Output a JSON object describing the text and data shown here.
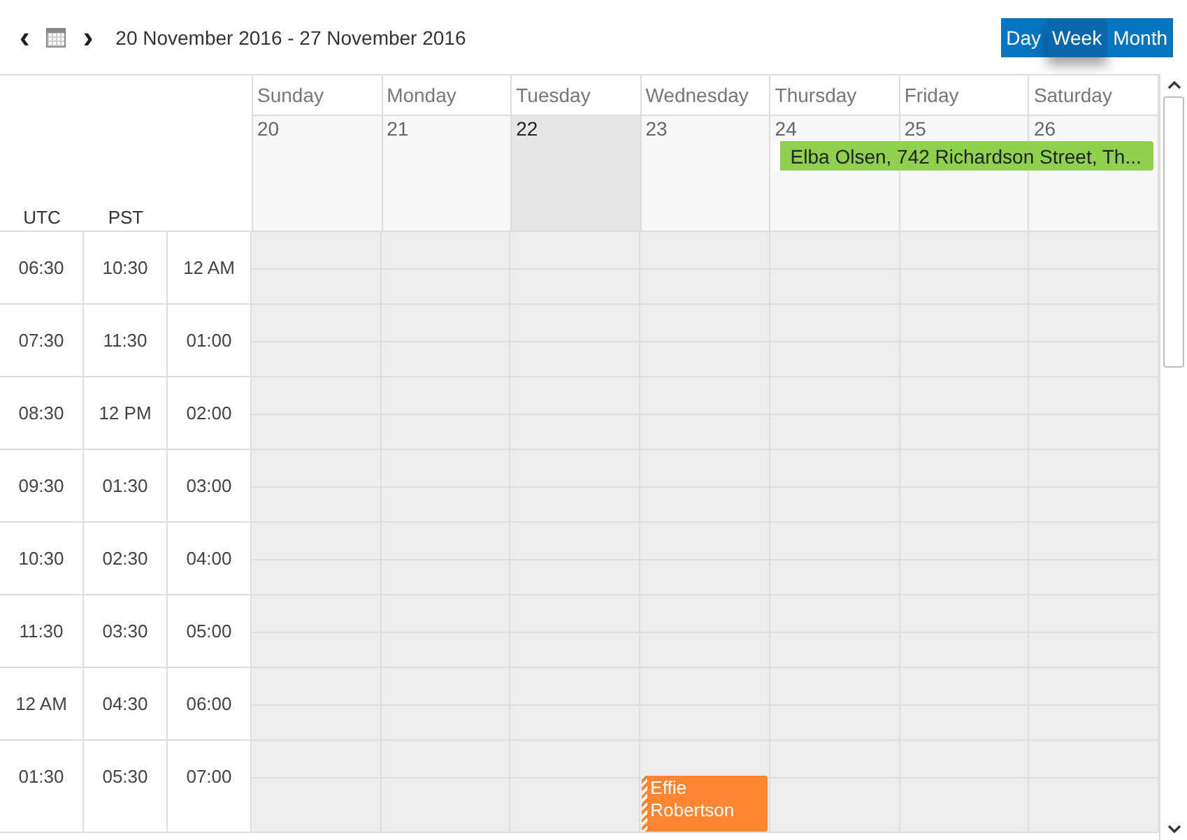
{
  "toolbar": {
    "prev": "‹",
    "next": "›",
    "range": "20 November 2016 - 27 November 2016",
    "views": [
      {
        "label": "Day",
        "selected": false
      },
      {
        "label": "Week",
        "selected": true
      },
      {
        "label": "Month",
        "selected": false
      }
    ]
  },
  "timezones": [
    "UTC",
    "PST"
  ],
  "days": [
    {
      "name": "Sunday",
      "date": "20",
      "today": false
    },
    {
      "name": "Monday",
      "date": "21",
      "today": false
    },
    {
      "name": "Tuesday",
      "date": "22",
      "today": true
    },
    {
      "name": "Wednesday",
      "date": "23",
      "today": false,
      "timed_events": [
        {
          "title": "Effie Robertson",
          "color": "#fd8532"
        }
      ]
    },
    {
      "name": "Thursday",
      "date": "24",
      "today": false,
      "all_day_events": [
        {
          "title": "Elba Olsen, 742 Richardson Street, Th...",
          "color": "#8fd14f",
          "runs_to_week_end": true
        }
      ]
    },
    {
      "name": "Friday",
      "date": "25",
      "today": false
    },
    {
      "name": "Saturday",
      "date": "26",
      "today": false
    }
  ],
  "time_rows": [
    {
      "times": [
        "06:30",
        "10:30",
        "12 AM"
      ],
      "events_start": false
    },
    {
      "times": [
        "07:30",
        "11:30",
        "01:00"
      ],
      "events_start": false
    },
    {
      "times": [
        "08:30",
        "12 PM",
        "02:00"
      ],
      "events_start": false
    },
    {
      "times": [
        "09:30",
        "01:30",
        "03:00"
      ],
      "events_start": false
    },
    {
      "times": [
        "10:30",
        "02:30",
        "04:00"
      ],
      "events_start": false
    },
    {
      "times": [
        "11:30",
        "03:30",
        "05:00"
      ],
      "events_start": false
    },
    {
      "times": [
        "12 AM",
        "04:30",
        "06:00"
      ],
      "events_start": false
    },
    {
      "times": [
        "01:30",
        "05:30",
        "07:00"
      ],
      "events_start": true
    }
  ]
}
